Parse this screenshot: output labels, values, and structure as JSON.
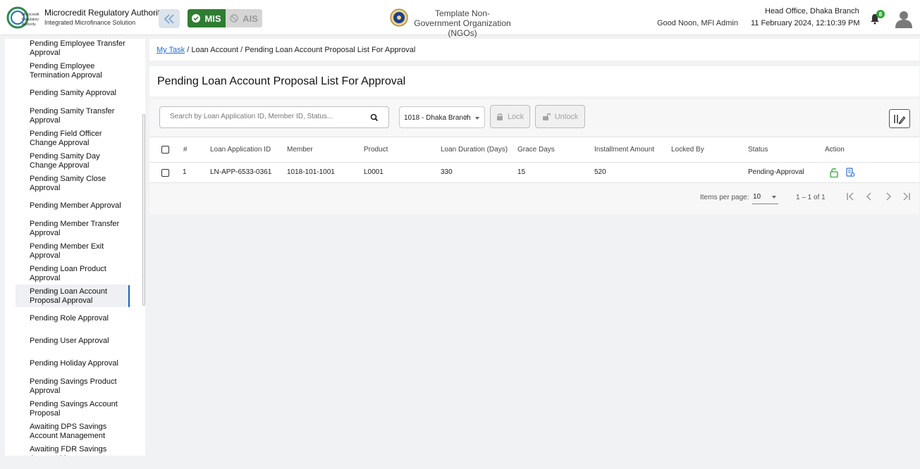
{
  "header": {
    "org_title": "Microcredit Regulatory Authority",
    "org_subtitle": "Integrated Microfinance Solution",
    "logo_text": [
      "Microcredit",
      "Regulatory",
      "Authority"
    ],
    "modules": [
      {
        "label": "MIS",
        "active": true
      },
      {
        "label": "AIS",
        "active": false
      }
    ],
    "ngo_name": "Template Non-Government Organization (NGOs)",
    "greeting": "Good Noon, MFI Admin",
    "branch": "Head Office, Dhaka Branch",
    "datetime": "11 February 2024, 12:10:39 PM",
    "notification_count": "8",
    "colors": {
      "mis_active": "#2e7d32",
      "badge": "#2ea836"
    }
  },
  "sidebar": {
    "items": [
      {
        "label": "Pending Employee Transfer Approval"
      },
      {
        "label": "Pending Employee Termination Approval"
      },
      {
        "label": "Pending Samity Approval"
      },
      {
        "label": "Pending Samity Transfer Approval"
      },
      {
        "label": "Pending Field Officer Change Approval"
      },
      {
        "label": "Pending Samity Day Change Approval"
      },
      {
        "label": "Pending Samity Close Approval"
      },
      {
        "label": "Pending Member Approval"
      },
      {
        "label": "Pending Member Transfer Approval"
      },
      {
        "label": "Pending Member Exit Approval"
      },
      {
        "label": "Pending Loan Product Approval"
      },
      {
        "label": "Pending Loan Account Proposal Approval",
        "active": true
      },
      {
        "label": "Pending Role Approval"
      },
      {
        "label": "Pending User Approval"
      },
      {
        "label": "Pending Holiday Approval"
      },
      {
        "label": "Pending Savings Product Approval"
      },
      {
        "label": "Pending Savings Account Proposal"
      },
      {
        "label": "Awaiting DPS Savings Account Management"
      },
      {
        "label": "Awaiting FDR Savings Account Management"
      }
    ]
  },
  "breadcrumb": {
    "items": [
      "My Task",
      "Loan Account",
      "Pending Loan Account Proposal List For Approval"
    ]
  },
  "page_title": "Pending Loan Account Proposal List For Approval",
  "toolbar": {
    "search_placeholder": "Search by Loan Application ID, Member ID, Status...",
    "branch_value": "1018 - Dhaka Branch",
    "lock_label": "Lock",
    "unlock_label": "Unlock"
  },
  "table": {
    "columns": [
      "#",
      "Loan Application ID",
      "Member",
      "Product",
      "Loan Duration (Days)",
      "Grace Days",
      "Installment Amount",
      "Locked By",
      "Status",
      "Action"
    ],
    "rows": [
      {
        "no": "1",
        "loan_app_id": "LN-APP-6533-0361",
        "member": "1018-101-1001",
        "product": "L0001",
        "duration": "330",
        "grace": "15",
        "installment": "520",
        "locked_by": "",
        "status": "Pending-Approval"
      }
    ]
  },
  "pagination": {
    "items_per_page_label": "Items per page:",
    "items_per_page": "10",
    "range": "1 – 1 of 1"
  }
}
